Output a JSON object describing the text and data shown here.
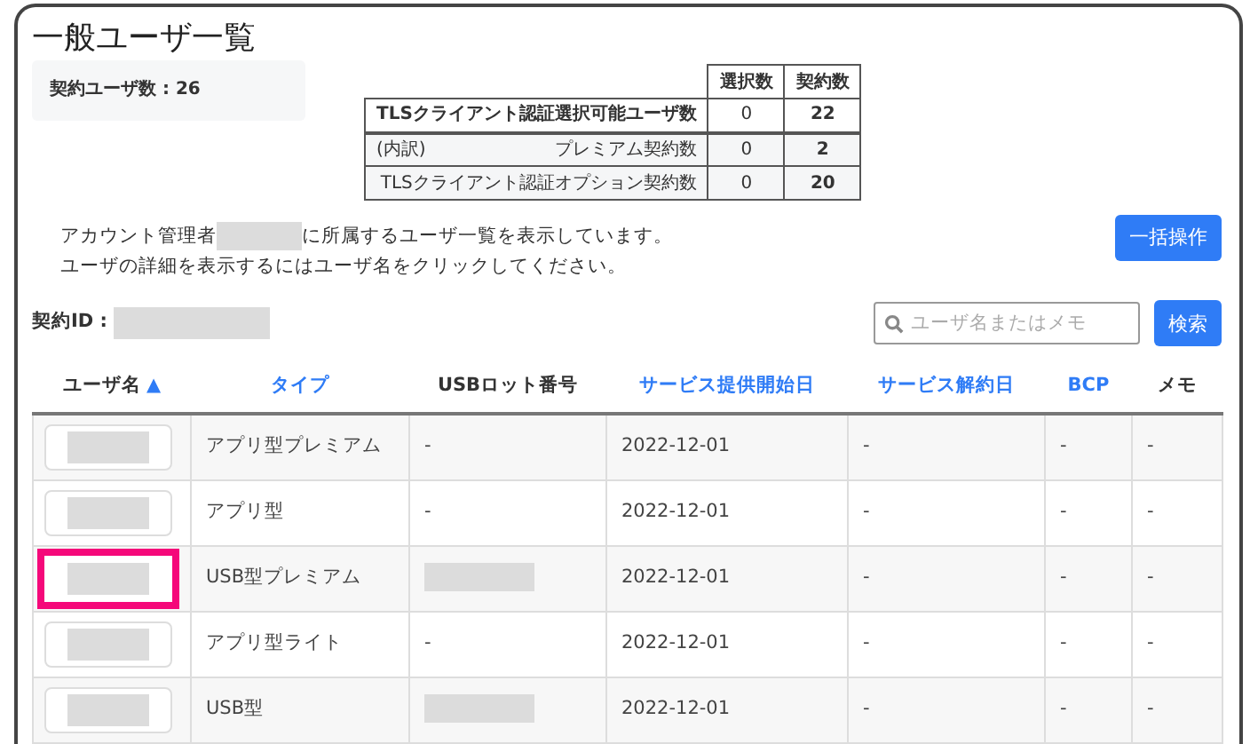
{
  "title": "一般ユーザ一覧",
  "contract_users": {
    "label": "契約ユーザ数 : 26"
  },
  "summary_table": {
    "columns": [
      "選択数",
      "契約数"
    ],
    "rows": [
      {
        "label": "TLSクライアント認証選択可能ユーザ数",
        "prefix": "",
        "bold": true,
        "values": [
          "0",
          "22"
        ]
      },
      {
        "prefix": "(内訳)",
        "label": "プレミアム契約数",
        "bold": false,
        "values": [
          "0",
          "2"
        ]
      },
      {
        "prefix": "",
        "label": "TLSクライアント認証オプション契約数",
        "bold": false,
        "values": [
          "0",
          "20"
        ]
      }
    ]
  },
  "description": {
    "line_1_before": "アカウント管理者",
    "line_1_after": "に所属するユーザ一覧を表示しています。",
    "line_2": "ユーザの詳細を表示するにはユーザ名をクリックしてください。"
  },
  "bulk_button": "一括操作",
  "contract_id_label": "契約ID :",
  "search": {
    "placeholder": "ユーザ名またはメモ",
    "button": "検索"
  },
  "table": {
    "columns": [
      {
        "label": "ユーザ名",
        "link": false,
        "sort": "▲"
      },
      {
        "label": "タイプ",
        "link": true
      },
      {
        "label": "USBロット番号",
        "link": false
      },
      {
        "label": "サービス提供開始日",
        "link": true
      },
      {
        "label": "サービス解約日",
        "link": true
      },
      {
        "label": "BCP",
        "link": true
      },
      {
        "label": "メモ",
        "link": false
      }
    ],
    "rows": [
      {
        "highlighted": false,
        "type": "アプリ型プレミアム",
        "usb_lot": "-",
        "start": "2022-12-01",
        "end": "-",
        "bcp": "-",
        "memo": "-"
      },
      {
        "highlighted": false,
        "type": "アプリ型",
        "usb_lot": "-",
        "start": "2022-12-01",
        "end": "-",
        "bcp": "-",
        "memo": "-"
      },
      {
        "highlighted": true,
        "type": "USB型プレミアム",
        "usb_lot": "",
        "start": "2022-12-01",
        "end": "-",
        "bcp": "-",
        "memo": "-"
      },
      {
        "highlighted": false,
        "type": "アプリ型ライト",
        "usb_lot": "-",
        "start": "2022-12-01",
        "end": "-",
        "bcp": "-",
        "memo": "-"
      },
      {
        "highlighted": false,
        "type": "USB型",
        "usb_lot": "",
        "start": "2022-12-01",
        "end": "-",
        "bcp": "-",
        "memo": "-"
      }
    ]
  }
}
